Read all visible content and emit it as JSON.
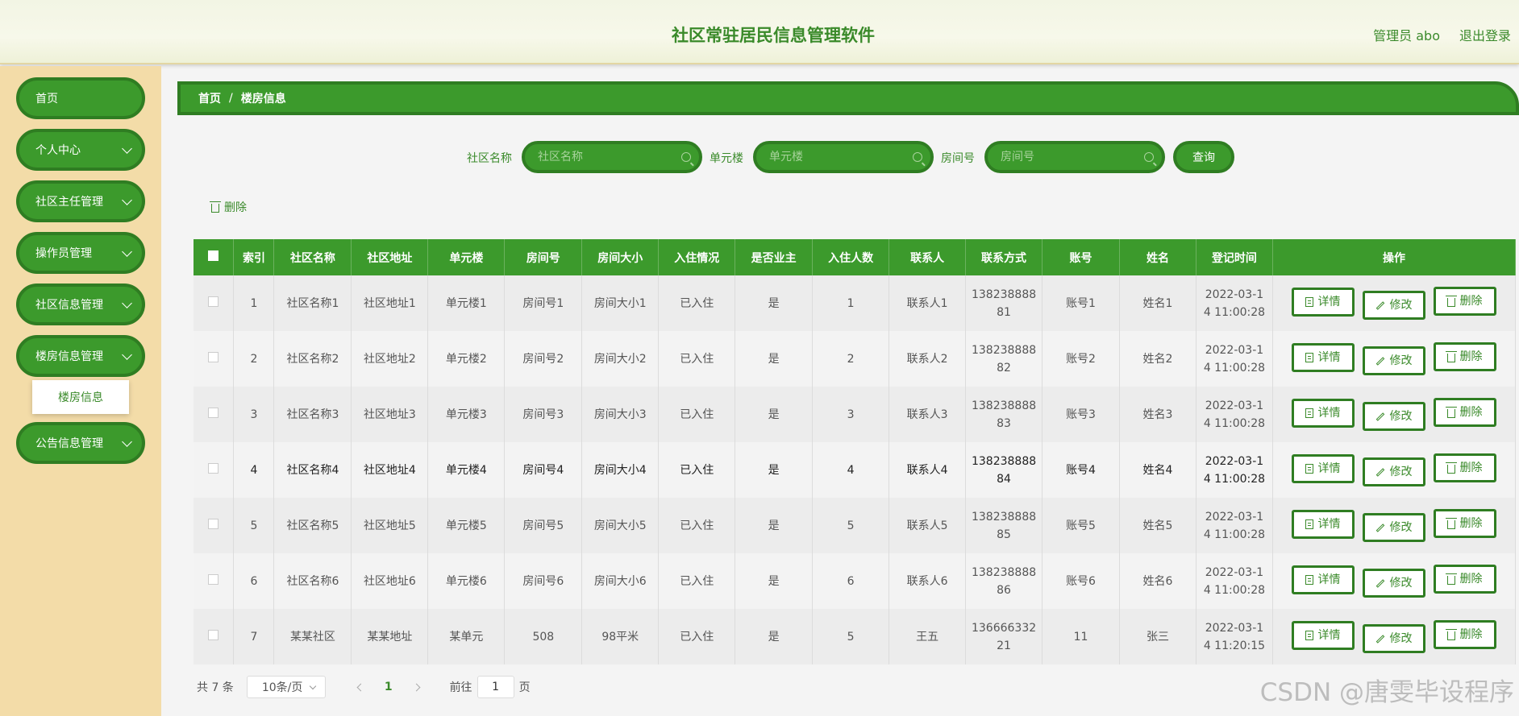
{
  "header": {
    "title": "社区常驻居民信息管理软件",
    "user": "管理员 abo",
    "logout": "退出登录"
  },
  "sidebar": {
    "items": [
      {
        "label": "首页"
      },
      {
        "label": "个人中心"
      },
      {
        "label": "社区主任管理"
      },
      {
        "label": "操作员管理"
      },
      {
        "label": "社区信息管理"
      },
      {
        "label": "楼房信息管理"
      },
      {
        "label": "公告信息管理"
      }
    ],
    "submenu": "楼房信息"
  },
  "breadcrumb": {
    "home": "首页",
    "sep": "/",
    "current": "楼房信息"
  },
  "search": {
    "community_label": "社区名称",
    "community_placeholder": "社区名称",
    "unit_label": "单元楼",
    "unit_placeholder": "单元楼",
    "room_label": "房间号",
    "room_placeholder": "房间号",
    "query": "查询"
  },
  "bulk_delete": "删除",
  "table": {
    "headers": [
      "索引",
      "社区名称",
      "社区地址",
      "单元楼",
      "房间号",
      "房间大小",
      "入住情况",
      "是否业主",
      "入住人数",
      "联系人",
      "联系方式",
      "账号",
      "姓名",
      "登记时间",
      "操作"
    ],
    "rows": [
      [
        "1",
        "社区名称1",
        "社区地址1",
        "单元楼1",
        "房间号1",
        "房间大小1",
        "已入住",
        "是",
        "1",
        "联系人1",
        "138238888\n81",
        "账号1",
        "姓名1",
        "2022-03-1\n4 11:00:28"
      ],
      [
        "2",
        "社区名称2",
        "社区地址2",
        "单元楼2",
        "房间号2",
        "房间大小2",
        "已入住",
        "是",
        "2",
        "联系人2",
        "138238888\n82",
        "账号2",
        "姓名2",
        "2022-03-1\n4 11:00:28"
      ],
      [
        "3",
        "社区名称3",
        "社区地址3",
        "单元楼3",
        "房间号3",
        "房间大小3",
        "已入住",
        "是",
        "3",
        "联系人3",
        "138238888\n83",
        "账号3",
        "姓名3",
        "2022-03-1\n4 11:00:28"
      ],
      [
        "4",
        "社区名称4",
        "社区地址4",
        "单元楼4",
        "房间号4",
        "房间大小4",
        "已入住",
        "是",
        "4",
        "联系人4",
        "138238888\n84",
        "账号4",
        "姓名4",
        "2022-03-1\n4 11:00:28"
      ],
      [
        "5",
        "社区名称5",
        "社区地址5",
        "单元楼5",
        "房间号5",
        "房间大小5",
        "已入住",
        "是",
        "5",
        "联系人5",
        "138238888\n85",
        "账号5",
        "姓名5",
        "2022-03-1\n4 11:00:28"
      ],
      [
        "6",
        "社区名称6",
        "社区地址6",
        "单元楼6",
        "房间号6",
        "房间大小6",
        "已入住",
        "是",
        "6",
        "联系人6",
        "138238888\n86",
        "账号6",
        "姓名6",
        "2022-03-1\n4 11:00:28"
      ],
      [
        "7",
        "某某社区",
        "某某地址",
        "某单元",
        "508",
        "98平米",
        "已入住",
        "是",
        "5",
        "王五",
        "136666332\n21",
        "11",
        "张三",
        "2022-03-1\n4 11:20:15"
      ]
    ],
    "actions": {
      "detail": "详情",
      "edit": "修改",
      "delete": "删除"
    }
  },
  "pagination": {
    "total": "共 7 条",
    "page_size": "10条/页",
    "current": "1",
    "goto_prefix": "前往",
    "goto_value": "1",
    "goto_suffix": "页"
  },
  "watermark": "CSDN @唐雯毕设程序"
}
